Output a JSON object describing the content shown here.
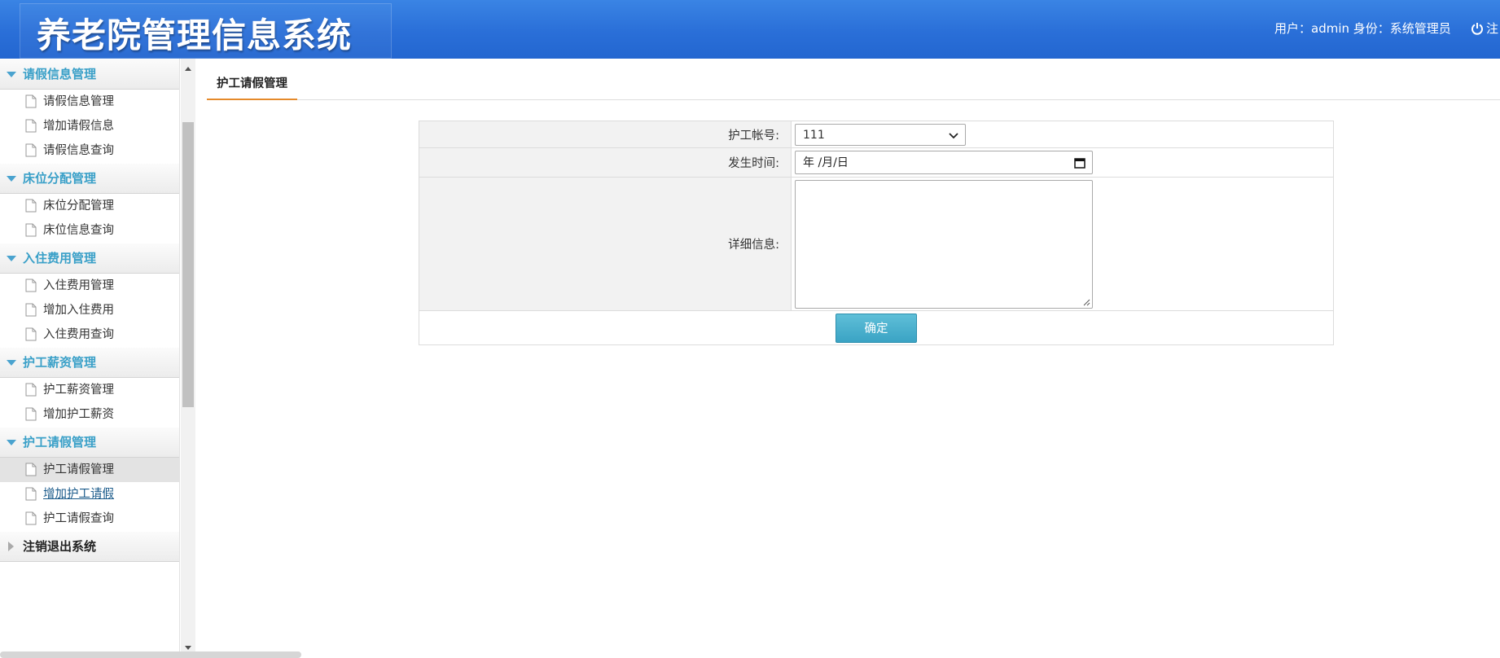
{
  "header": {
    "title": "养老院管理信息系统",
    "user_label": "用户：admin 身份：系统管理员",
    "logout_label": "注"
  },
  "sidebar": {
    "groups": [
      {
        "title": "请假信息管理",
        "items": [
          "请假信息管理",
          "增加请假信息",
          "请假信息查询"
        ]
      },
      {
        "title": "床位分配管理",
        "items": [
          "床位分配管理",
          "床位信息查询"
        ]
      },
      {
        "title": "入住费用管理",
        "items": [
          "入住费用管理",
          "增加入住费用",
          "入住费用查询"
        ]
      },
      {
        "title": "护工薪资管理",
        "items": [
          "护工薪资管理",
          "增加护工薪资"
        ]
      },
      {
        "title": "护工请假管理",
        "items": [
          "护工请假管理",
          "增加护工请假",
          "护工请假查询"
        ]
      }
    ],
    "logout_group": "注销退出系统"
  },
  "main": {
    "tab_label": "护工请假管理",
    "form": {
      "account_label": "护工帐号:",
      "account_value": "111",
      "time_label": "发生时间:",
      "time_value": "年 /月/日",
      "detail_label": "详细信息:",
      "submit_label": "确定"
    }
  }
}
